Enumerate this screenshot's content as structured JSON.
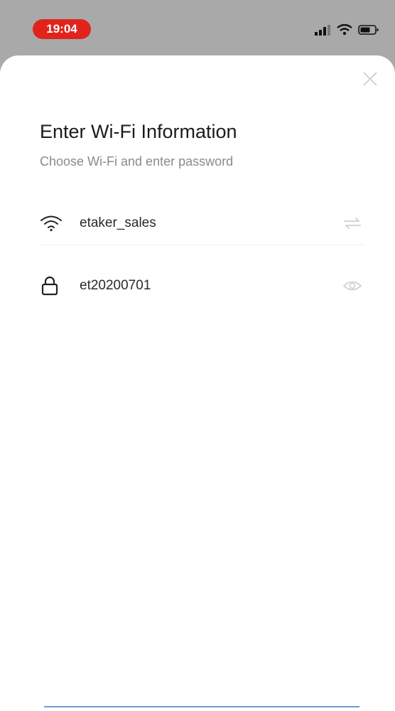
{
  "status_bar": {
    "time": "19:04",
    "icons": [
      "signal-icon",
      "wifi-icon",
      "battery-icon"
    ]
  },
  "sheet": {
    "title": "Enter Wi-Fi Information",
    "subtitle": "Choose Wi-Fi and enter password",
    "wifi_row": {
      "icon": "wifi-icon",
      "value": "etaker_sales",
      "action_icon": "switch-network-icon"
    },
    "password_row": {
      "icon": "lock-icon",
      "value": "et20200701",
      "action_icon": "eye-icon"
    }
  },
  "colors": {
    "time_pill": "#e0241c",
    "title": "#1b1b1b",
    "subtitle": "#8a8a8a",
    "accent_line": "#6e9bd6"
  }
}
